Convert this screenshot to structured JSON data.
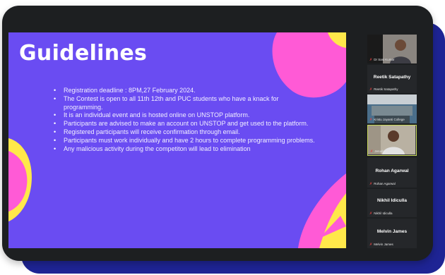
{
  "slide": {
    "title": "Guidelines",
    "bullets": [
      "Registration deadline : 8PM,27   February 2024.",
      "The Contest is open to all 11th 12th and PUC students who have a knack for programming.",
      "It is an individual event and is hosted online on UNSTOP platform.",
      "Participants are advised to make an account on UNSTOP and get used to the platform.",
      "Registered participants will receive confirmation through email.",
      "Participants must work individually and have 2 hours to complete programming problems.",
      "Any malicious activity during the competiton will lead to elimination"
    ],
    "colors": {
      "background": "#6a4cf2",
      "pink": "#ff5ad6",
      "yellow": "#ffe84a"
    }
  },
  "participants": [
    {
      "name": "",
      "tag": "Dr Sasi Kumar",
      "type": "video"
    },
    {
      "name": "Reetik Satapathy",
      "tag": "Reetik Satapathy",
      "type": "name"
    },
    {
      "name": "",
      "tag": "Kristu Jayanti College",
      "type": "video"
    },
    {
      "name": "",
      "tag": "Jerusha",
      "type": "video-active"
    },
    {
      "name": "Rohan Agarwal",
      "tag": "Rohan Agarwal",
      "type": "name"
    },
    {
      "name": "Nikhil Idiculla",
      "tag": "Nikhil Idiculla",
      "type": "name"
    },
    {
      "name": "Melvin James",
      "tag": "Melvin James",
      "type": "name"
    }
  ],
  "icons": {
    "mic_muted": "mic-muted-icon"
  }
}
